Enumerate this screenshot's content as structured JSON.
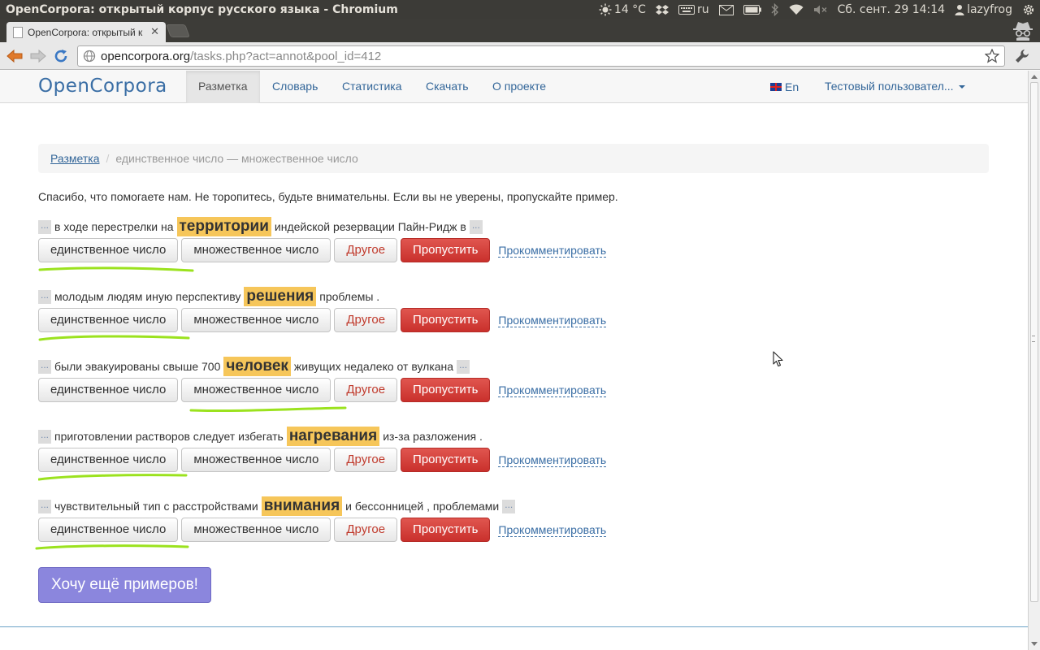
{
  "os": {
    "window_title": "OpenCorpora: открытый корпус русского языка - Chromium",
    "weather": "14 °C",
    "keyboard_layout": "ru",
    "datetime": "Сб. сент. 29 14:14",
    "username": "lazyfrog"
  },
  "browser": {
    "tab_title": "OpenCorpora: открытый к",
    "url_host": "opencorpora.org",
    "url_path": "/tasks.php?act=annot&pool_id=412"
  },
  "nav": {
    "brand": "OpenCorpora",
    "items": [
      "Разметка",
      "Словарь",
      "Статистика",
      "Скачать",
      "О проекте"
    ],
    "language": "En",
    "user": "Тестовый пользовател..."
  },
  "breadcrumb": {
    "root": "Разметка",
    "sep": "/",
    "current": "единственное число — множественное число"
  },
  "intro": "Спасибо, что помогаете нам. Не торопитесь, будьте внимательны. Если вы не уверены, пропускайте пример.",
  "labels": {
    "more": "...",
    "singular": "единственное число",
    "plural": "множественное число",
    "other": "Другое",
    "skip": "Пропустить",
    "comment": "Прокомментировать"
  },
  "samples": [
    {
      "left": "в ходе перестрелки на",
      "target": "территории",
      "right": "индейской резервации Пайн-Ридж в",
      "more_after": true,
      "marked": "singular"
    },
    {
      "left": "молодым людям иную перспективу",
      "target": "решения",
      "right": "проблемы .",
      "more_after": false,
      "marked": "singular"
    },
    {
      "left": "были эвакуированы свыше 700",
      "target": "человек",
      "right": "живущих недалеко от вулкана",
      "more_after": true,
      "marked": "plural"
    },
    {
      "left": "приготовлении растворов следует избегать",
      "target": "нагревания",
      "right": "из-за разложения .",
      "more_after": false,
      "marked": "singular"
    },
    {
      "left": "чувствительный тип с расстройствами",
      "target": "внимания",
      "right": "и бессонницей , проблемами",
      "more_after": true,
      "marked": "singular"
    }
  ],
  "more_button": "Хочу ещё примеров!",
  "colors": {
    "highlight": "#f6c65a",
    "skip_button": "#d9534f",
    "more_button": "#8b86dd",
    "annotation_mark": "#9be21e"
  }
}
